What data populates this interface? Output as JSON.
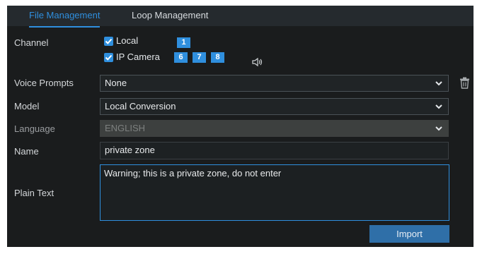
{
  "tabs": [
    {
      "label": "File Management",
      "active": true
    },
    {
      "label": "Loop Management",
      "active": false
    }
  ],
  "channel": {
    "label": "Channel",
    "local": {
      "label": "Local",
      "checked": true,
      "channels": [
        "1"
      ]
    },
    "ip_camera": {
      "label": "IP Camera",
      "checked": true,
      "channels": [
        "6",
        "7",
        "8"
      ]
    }
  },
  "voice_prompts": {
    "label": "Voice Prompts",
    "value": "None"
  },
  "model": {
    "label": "Model",
    "value": "Local Conversion"
  },
  "language": {
    "label": "Language",
    "value": "ENGLISH",
    "disabled": true
  },
  "name": {
    "label": "Name",
    "value": "private zone"
  },
  "plain_text": {
    "label": "Plain Text",
    "value": "Warning; this is a private zone, do not enter"
  },
  "import_button": "Import",
  "icons": {
    "speaker": "speaker-icon",
    "delete": "trash-icon",
    "dropdown": "chevron-down-icon",
    "check": "checkmark-icon"
  },
  "colors": {
    "accent": "#2f8fde",
    "panel": "#1a1c1d",
    "tabbar": "#252a2e",
    "button": "#2f6fa8"
  }
}
